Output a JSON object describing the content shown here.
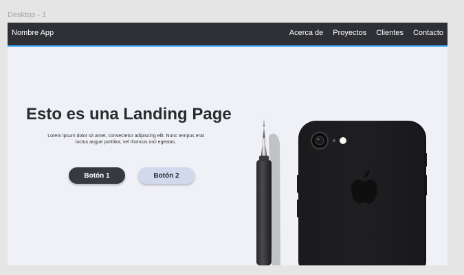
{
  "frame": {
    "label": "Desktop - 1"
  },
  "navbar": {
    "brand": "Nombre App",
    "links": [
      {
        "label": "Acerca de"
      },
      {
        "label": "Proyectos"
      },
      {
        "label": "Clientes"
      },
      {
        "label": "Contacto"
      }
    ]
  },
  "hero": {
    "title": "Esto es una Landing Page",
    "text": "Lorem ipsum dolor sit amet, consectetur adipiscing elit. Nunc tempus erat luctus augue porttitor, vel rhoncus orci egestas.",
    "button_primary": "Botón 1",
    "button_secondary": "Botón 2"
  },
  "colors": {
    "navbar_bg": "#2f3035",
    "selection_outline": "#2f9df0",
    "page_bg": "#f0f1f6",
    "button_primary": "#383940",
    "button_secondary": "#d3d9ec"
  },
  "image": {
    "icon": "iphone-and-pen-photo"
  }
}
